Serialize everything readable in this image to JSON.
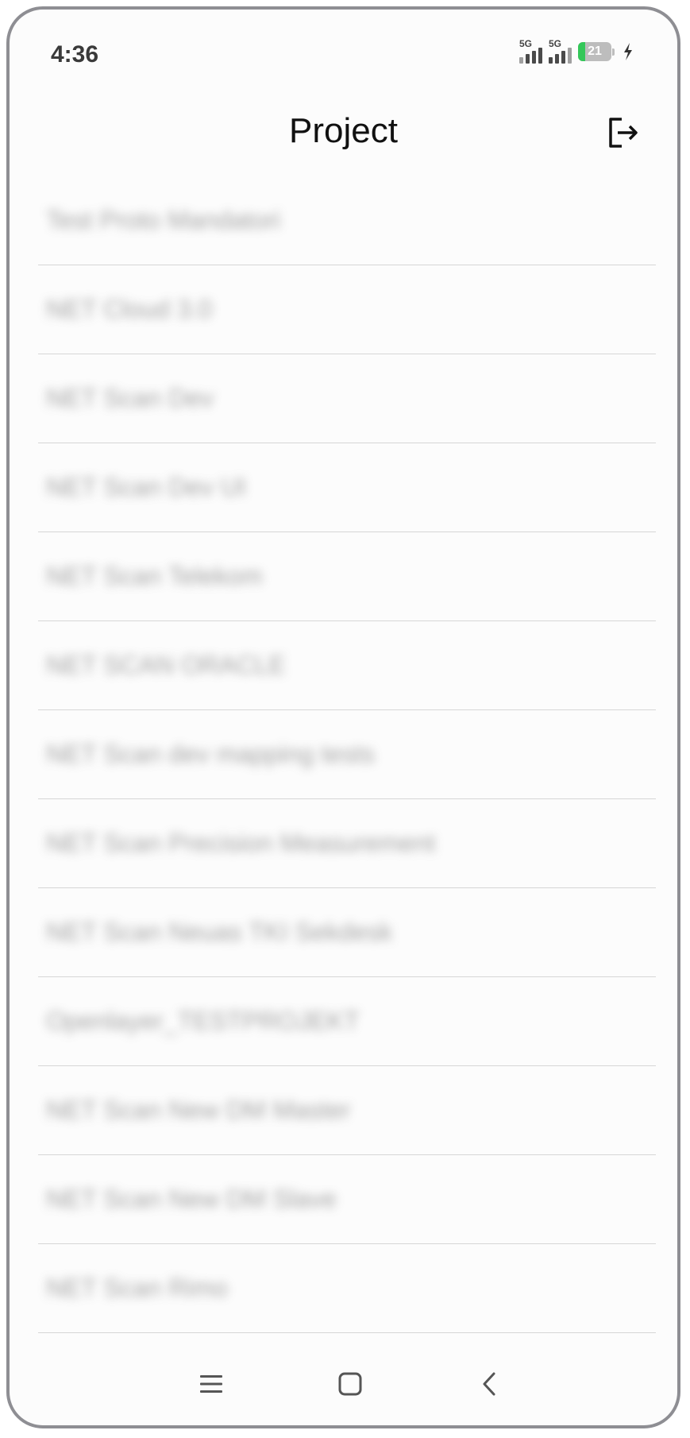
{
  "status_bar": {
    "time": "4:36",
    "signal_1_label": "5G",
    "signal_2_label": "5G",
    "battery_percent": "21",
    "battery_level": 0.21,
    "battery_color": "#34c759"
  },
  "header": {
    "title": "Project",
    "logout_icon": "logout-icon"
  },
  "projects": [
    {
      "name": "Test Proto Mandatori"
    },
    {
      "name": "NET Cloud 3.0"
    },
    {
      "name": "NET Scan Dev"
    },
    {
      "name": "NET Scan Dev UI"
    },
    {
      "name": "NET Scan Telekom"
    },
    {
      "name": "NET SCAN ORACLE"
    },
    {
      "name": "NET Scan dev mapping tests"
    },
    {
      "name": "NET Scan Precision Measurement"
    },
    {
      "name": "NET Scan Neuas TKI Sekdesk"
    },
    {
      "name": "Openlayer_TESTPROJEKT"
    },
    {
      "name": "NET Scan New DM Master"
    },
    {
      "name": "NET Scan New DM Slave"
    },
    {
      "name": "NET Scan Rimo"
    }
  ],
  "nav_bar": {
    "menu_icon": "menu-icon",
    "home_icon": "home-icon",
    "back_icon": "back-icon"
  }
}
